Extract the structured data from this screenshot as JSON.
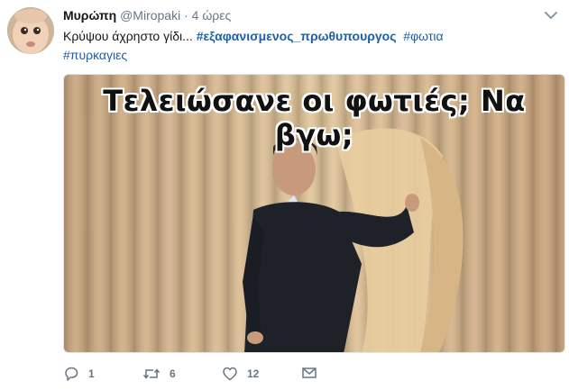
{
  "tweet": {
    "name": "Μυρώπη",
    "handle": "@Miropaki",
    "separator": "·",
    "time": "4 ώρες",
    "text_before": "Κρύψου άχρηστο γίδι... ",
    "hashtags": [
      "#εξαφανισμενος_πρωθυπουργος",
      "#φωτια",
      "#πυρκαγιες"
    ]
  },
  "media": {
    "caption": "Τελειώσανε οι φωτιές; Να βγω;"
  },
  "actions": {
    "replies": "1",
    "retweets": "6",
    "likes": "12"
  },
  "icons": {
    "reply": "reply-icon",
    "retweet": "retweet-icon",
    "like": "heart-icon",
    "message": "envelope-icon",
    "menu": "chevron-down-icon"
  },
  "colors": {
    "accent": "#1c5faa",
    "muted": "#657786"
  }
}
